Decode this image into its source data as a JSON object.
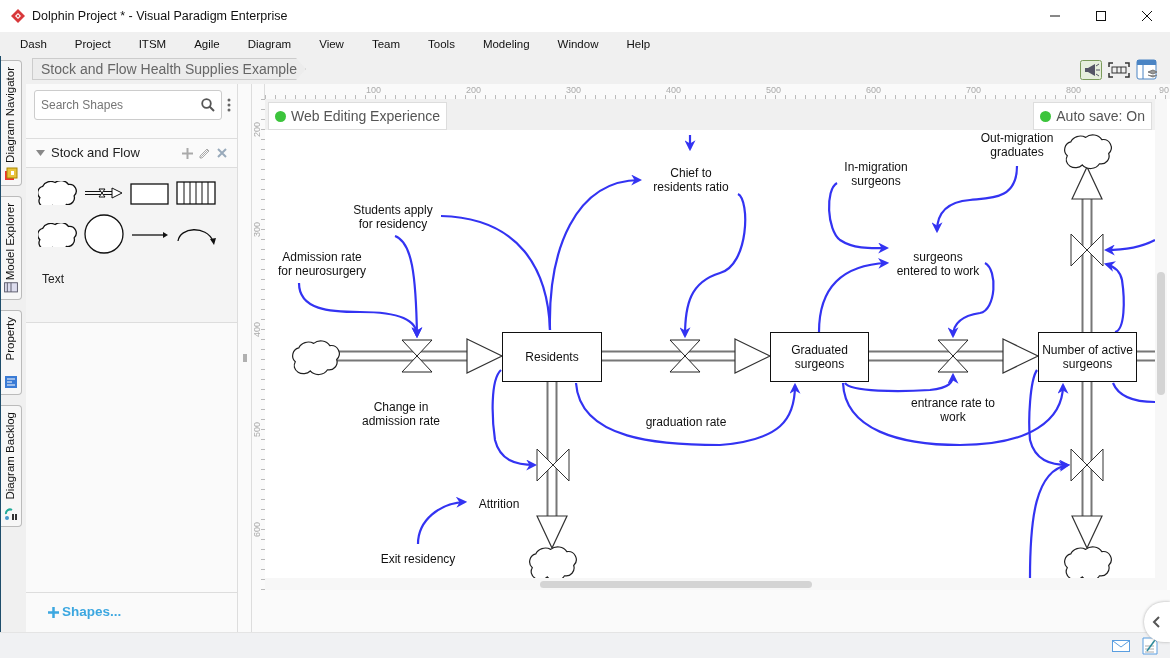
{
  "window": {
    "title": "Dolphin Project * - Visual Paradigm Enterprise"
  },
  "menu": [
    "Dash",
    "Project",
    "ITSM",
    "Agile",
    "Diagram",
    "View",
    "Team",
    "Tools",
    "Modeling",
    "Window",
    "Help"
  ],
  "side_tabs": [
    "Diagram Navigator",
    "Model Explorer",
    "Property",
    "Diagram Backlog"
  ],
  "breadcrumb": "Stock and Flow Health Supplies Example",
  "shape_search": {
    "placeholder": "Search Shapes"
  },
  "palette": {
    "title": "Stock and Flow",
    "expanded": true,
    "shapes": [
      {
        "kind": "cloud"
      },
      {
        "kind": "flow"
      },
      {
        "kind": "stock"
      },
      {
        "kind": "conveyor"
      },
      {
        "kind": "cloud"
      },
      {
        "kind": "converter"
      },
      {
        "kind": "connector"
      },
      {
        "kind": "curved_connector"
      },
      {
        "kind": "text",
        "label": "Text"
      }
    ]
  },
  "more_shapes": "Shapes...",
  "ruler": {
    "horizontal": [
      "100",
      "200",
      "300",
      "400",
      "500",
      "600",
      "700",
      "800",
      "90"
    ],
    "vertical": [
      "200",
      "300",
      "400",
      "500",
      "600"
    ]
  },
  "status_chips": [
    "Web Editing Experience",
    "Auto save: On"
  ],
  "diagram": {
    "stocks": [
      "Residents",
      "Graduated\nsurgeons",
      "Number of active\nsurgeons"
    ],
    "variables": [
      "Out-migration\ngraduates",
      "Chief to\nresidents ratio",
      "In-migration\nsurgeons",
      "Students apply\nfor residency",
      "Admission rate\nfor neurosurgery",
      "surgeons\nentered to work",
      "Change in\nadmission rate",
      "entrance rate to\nwork",
      "graduation rate",
      "Attrition",
      "Exit residency"
    ]
  }
}
